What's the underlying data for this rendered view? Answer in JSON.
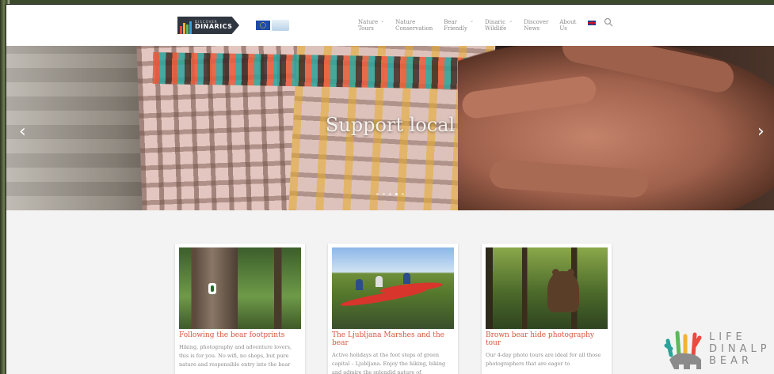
{
  "header": {
    "logo_main_small": "DISCOVER",
    "logo_main_big": "DINARICS",
    "nav": [
      {
        "label": "Nature\nTours",
        "has_dropdown": true
      },
      {
        "label": "Nature\nConservation",
        "has_dropdown": false
      },
      {
        "label": "Bear\nFriendly",
        "has_dropdown": true
      },
      {
        "label": "Dinaric\nWildlife",
        "has_dropdown": true
      },
      {
        "label": "Discover\nNews",
        "has_dropdown": false
      },
      {
        "label": "About\nUs",
        "has_dropdown": false
      }
    ],
    "language_icon": "uk-flag-icon",
    "search_icon": "search-icon"
  },
  "hero": {
    "title": "Support local",
    "prev_icon": "chevron-left-icon",
    "next_icon": "chevron-right-icon",
    "slide_count": 5,
    "active_slide": 3
  },
  "cards": [
    {
      "title": "Following the bear footprints",
      "text": "Hiking, photography and adventure lovers, this is for you. No wifi, no shops, but pure nature and responsible entry into the bear"
    },
    {
      "title": "The Ljubljana Marshes and the bear",
      "text": "Active holidays at the foot steps of green capital – Ljubljana. Enjoy the hiking, biking and admire the splendid nature of"
    },
    {
      "title": "Brown bear hide photography tour",
      "text": "Our 4-day photo tours are ideal for all those photographers that are eager to"
    }
  ],
  "partner_logo": {
    "text": "LIFE\nDINALP\nBEAR"
  },
  "colors": {
    "accent": "#d9543d",
    "nav_text": "#8a8a8a",
    "page_bg": "#f3f3f3"
  }
}
